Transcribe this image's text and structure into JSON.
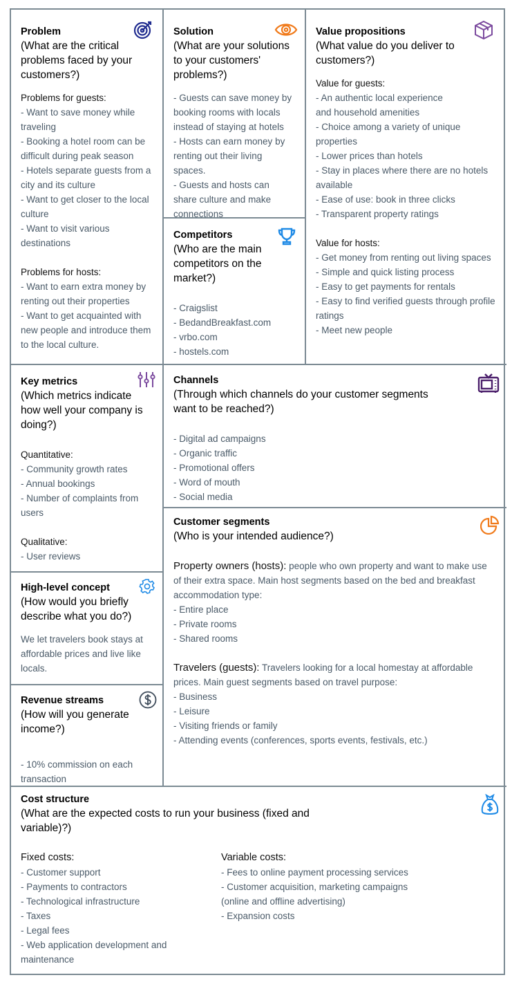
{
  "colors": {
    "border": "#7b8a93",
    "heading": "#000000",
    "body_text": "#4a5a68",
    "icon_navy": "#1f2b8f",
    "icon_orange": "#f07a1a",
    "icon_purple": "#7b4a9e",
    "icon_blue": "#1e8ae6",
    "icon_dark_purple": "#4b1f6b",
    "icon_slate": "#3e4b5a"
  },
  "problem": {
    "title": "Problem",
    "question": "(What are the critical problems faced by your customers?)",
    "icon": "target-icon",
    "guests_label": "Problems for guests:",
    "guests_items": [
      "- Want to save money while traveling",
      "- Booking a hotel room can be difficult during peak season",
      "- Hotels separate guests from a city and its culture",
      "- Want to get closer to the local culture",
      "- Want to visit various destinations"
    ],
    "hosts_label": "Problems for hosts:",
    "hosts_items": [
      "- Want to earn extra money by renting out their properties",
      "- Want to get acquainted with new people and introduce them to the local culture."
    ]
  },
  "solution": {
    "title": "Solution",
    "question": "(What are your solutions to your customers' problems?)",
    "icon": "eye-icon",
    "items": [
      "- Guests can save money by booking rooms with locals instead of staying at hotels",
      "- Hosts can earn money by renting out their living spaces.",
      "- Guests and hosts can share culture and make connections"
    ]
  },
  "competitors": {
    "title": "Competitors",
    "question": "(Who are the main competitors on the market?)",
    "icon": "trophy-icon",
    "items": [
      "- Craigslist",
      "- BedandBreakfast.com",
      "- vrbo.com",
      "- hostels.com"
    ]
  },
  "value_propositions": {
    "title": "Value propositions",
    "question": "(What value do you deliver to customers?)",
    "icon": "box-icon",
    "guests_label": "Value for guests:",
    "guests_items": [
      "- An authentic local experience and household amenities",
      "- Choice among a variety of unique properties",
      "- Lower prices than hotels",
      "- Stay in places where there are no hotels available",
      "- Ease of use: book in three clicks",
      "- Transparent property ratings"
    ],
    "hosts_label": "Value for hosts:",
    "hosts_items": [
      "- Get money from renting out living spaces",
      "- Simple and quick listing process",
      "- Easy to get payments for rentals",
      "- Easy to find verified guests through profile ratings",
      "- Meet new people"
    ]
  },
  "key_metrics": {
    "title": "Key metrics",
    "question": "(Which metrics indicate how well your company is doing?)",
    "icon": "sliders-icon",
    "quant_label": "Quantitative:",
    "quant_items": [
      "- Community growth rates",
      "- Annual bookings",
      "- Number of complaints from users"
    ],
    "qual_label": "Qualitative:",
    "qual_items": [
      "- User reviews"
    ]
  },
  "channels": {
    "title": "Channels",
    "question": "(Through which channels do your customer segments want to be reached?)",
    "icon": "tv-icon",
    "items": [
      "- Digital ad campaigns",
      "- Organic traffic",
      "- Promotional offers",
      "- Word of mouth",
      "- Social media"
    ]
  },
  "customer_segments": {
    "title": "Customer segments",
    "question": "(Who is your intended audience?)",
    "icon": "pie-chart-icon",
    "hosts_lead": "Property owners (hosts):",
    "hosts_desc": " people who own property and want to make use of their extra space. Main host segments based on the bed and breakfast accommodation type:",
    "hosts_items": [
      "- Entire place",
      "- Private rooms",
      "- Shared rooms"
    ],
    "guests_lead": "Travelers (guests):",
    "guests_desc": " Travelers looking for a local homestay at affordable prices. Main guest segments based on travel purpose:",
    "guests_items": [
      "- Business",
      "- Leisure",
      "- Visiting friends or family",
      "- Attending events (conferences, sports events, festivals, etc.)"
    ]
  },
  "high_level_concept": {
    "title": "High-level concept",
    "question": "(How would you briefly describe what you do?)",
    "icon": "gear-icon",
    "text": "We let travelers book stays at affordable prices and live like locals."
  },
  "revenue_streams": {
    "title": "Revenue streams",
    "question": "(How will you generate income?)",
    "icon": "dollar-circle-icon",
    "items": [
      "- 10% commission on each transaction"
    ]
  },
  "cost_structure": {
    "title": "Cost structure",
    "question": "(What are the expected costs to run your business (fixed and variable)?)",
    "icon": "money-bag-icon",
    "fixed_label": "Fixed costs:",
    "fixed_items": [
      "- Customer support",
      "- Payments to contractors",
      "- Technological infrastructure",
      "- Taxes",
      "- Legal fees",
      "- Web application development and maintenance"
    ],
    "variable_label": "Variable costs:",
    "variable_items": [
      "- Fees to online payment processing services",
      "- Customer acquisition, marketing campaigns (online and offline advertising)",
      "- Expansion costs"
    ]
  }
}
